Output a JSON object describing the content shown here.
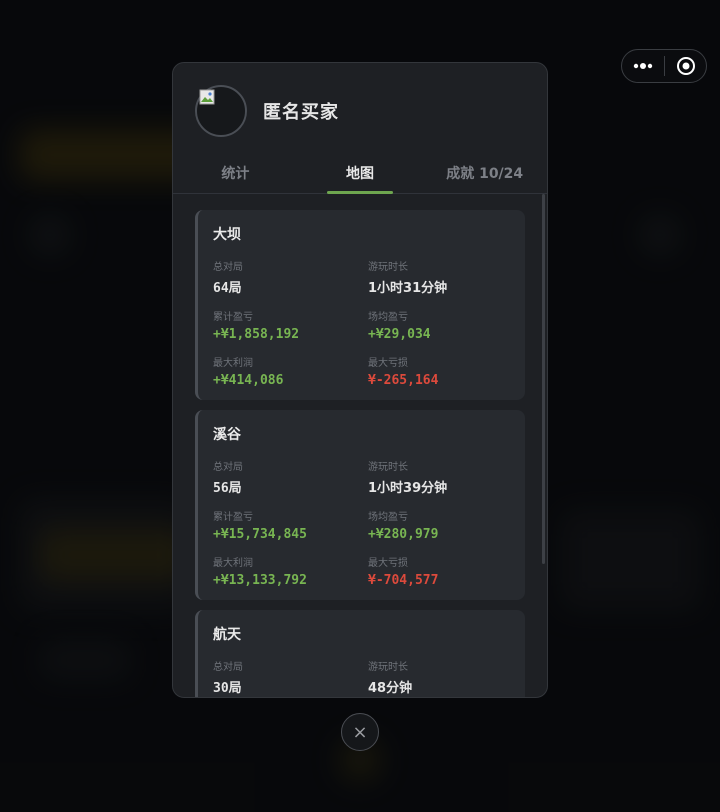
{
  "profile": {
    "username": "匿名买家"
  },
  "tabs": [
    {
      "label": "统计",
      "active": false
    },
    {
      "label": "地图",
      "active": true
    },
    {
      "label": "成就 10/24",
      "active": false
    }
  ],
  "maps": [
    {
      "name": "大坝",
      "total_games_label": "总对局",
      "total_games": "64局",
      "play_time_label": "游玩时长",
      "play_time": "1小时31分钟",
      "cum_pnl_label": "累计盈亏",
      "cum_pnl": "+¥1,858,192",
      "avg_pnl_label": "场均盈亏",
      "avg_pnl": "+¥29,034",
      "max_profit_label": "最大利润",
      "max_profit": "+¥414,086",
      "max_loss_label": "最大亏损",
      "max_loss": "¥-265,164"
    },
    {
      "name": "溪谷",
      "total_games_label": "总对局",
      "total_games": "56局",
      "play_time_label": "游玩时长",
      "play_time": "1小时39分钟",
      "cum_pnl_label": "累计盈亏",
      "cum_pnl": "+¥15,734,845",
      "avg_pnl_label": "场均盈亏",
      "avg_pnl": "+¥280,979",
      "max_profit_label": "最大利润",
      "max_profit": "+¥13,133,792",
      "max_loss_label": "最大亏损",
      "max_loss": "¥-704,577"
    },
    {
      "name": "航天",
      "total_games_label": "总对局",
      "total_games": "30局",
      "play_time_label": "游玩时长",
      "play_time": "48分钟"
    }
  ],
  "close_button": {
    "glyph": "×"
  },
  "capsule": {
    "more_icon": "more-dots-icon",
    "close_icon": "target-circle-icon"
  },
  "colors": {
    "accent": "#6ea64f",
    "positive": "#78b552",
    "negative": "#dd4a3c"
  }
}
